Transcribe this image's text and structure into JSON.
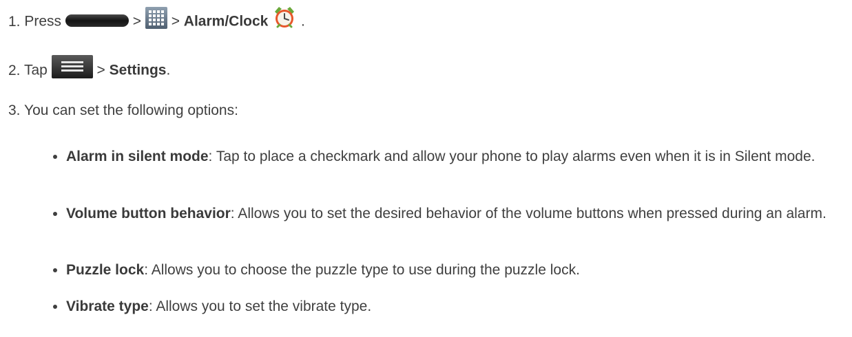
{
  "steps": [
    {
      "number": "1.",
      "parts": {
        "pre": "Press",
        "sep1": ">",
        "sep2": ">",
        "bold": "Alarm/Clock",
        "post": "."
      }
    },
    {
      "number": "2.",
      "parts": {
        "pre": "Tap",
        "sep1": ">",
        "bold": "Settings",
        "post": "."
      }
    },
    {
      "number": "3.",
      "text": "You can set the following options:"
    }
  ],
  "options": [
    {
      "term": "Alarm in silent mode",
      "desc": ": Tap to place a checkmark and allow your phone to play alarms even when it is in Silent mode."
    },
    {
      "term": "Volume button behavior",
      "desc": ": Allows you to set the desired behavior of the volume buttons when pressed during an alarm."
    },
    {
      "term": "Puzzle lock",
      "desc": ": Allows you to choose the puzzle type to use during the puzzle lock."
    },
    {
      "term": "Vibrate type",
      "desc": ": Allows you to set the vibrate type."
    }
  ],
  "icons": {
    "home_key": "home-key-icon",
    "apps": "apps-grid-icon",
    "alarm_clock": "alarm-clock-icon",
    "menu_key": "menu-key-icon"
  }
}
